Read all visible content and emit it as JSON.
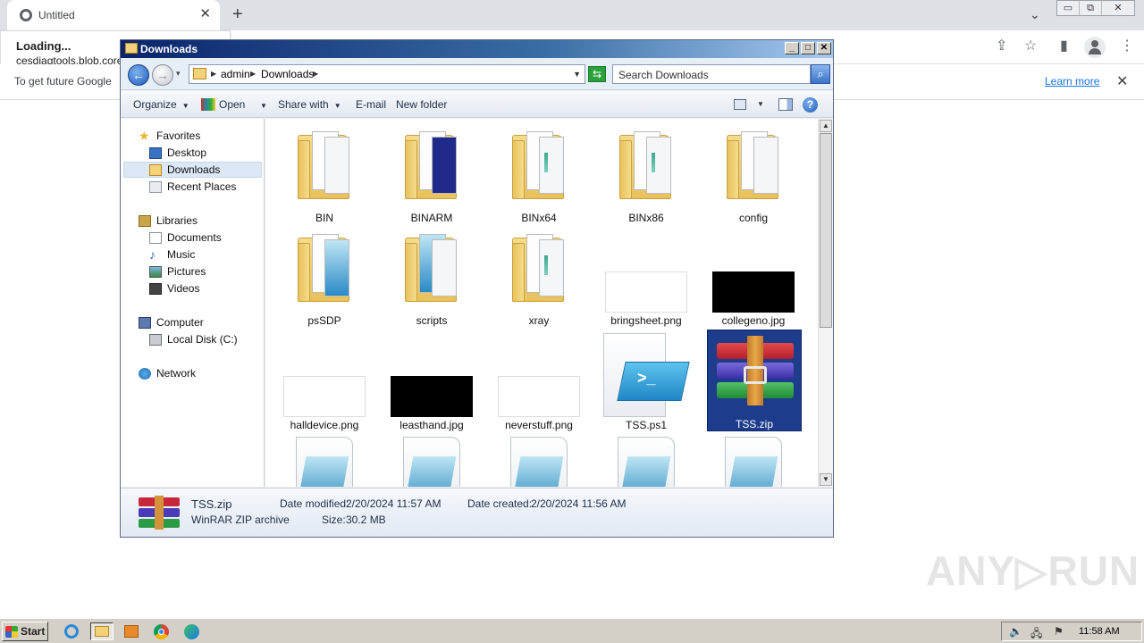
{
  "browser": {
    "tab_title": "Untitled",
    "tab_close": "✕",
    "new_tab": "+",
    "tab_dropdown": "⌄",
    "window_controls": [
      "▭",
      "⧉",
      "✕"
    ],
    "toolbar_icons": {
      "share": "⇪",
      "star": "☆",
      "sidepanel": "▮",
      "menu": "⋮"
    },
    "loading_title": "Loading...",
    "loading_url": "cesdiagtools.blob.core.windows.net",
    "infobar_message": "To get future Google",
    "learn_more": "Learn more",
    "infobar_close": "✕"
  },
  "explorer": {
    "title": "Downloads",
    "title_buttons": [
      "_",
      "□",
      "✕"
    ],
    "nav": {
      "back": "←",
      "forward": "→",
      "history": "▾"
    },
    "address": {
      "crumbs": [
        "admin",
        "Downloads"
      ],
      "arrow": "▶",
      "dropdown": "▼"
    },
    "refresh": "⇆",
    "search_placeholder": "Search Downloads",
    "search_button": "⌕",
    "commands": {
      "organize": "Organize",
      "open": "Open",
      "share_with": "Share with",
      "email": "E-mail",
      "new_folder": "New folder",
      "dropdown": "▼",
      "help": "?"
    },
    "nav_pane": {
      "favorites": "Favorites",
      "desktop": "Desktop",
      "downloads": "Downloads",
      "recent_places": "Recent Places",
      "libraries": "Libraries",
      "documents": "Documents",
      "music": "Music",
      "pictures": "Pictures",
      "videos": "Videos",
      "computer": "Computer",
      "local_disk": "Local Disk (C:)",
      "network": "Network"
    },
    "items": {
      "bin": "BIN",
      "binarm": "BINARM",
      "binx64": "BINx64",
      "binx86": "BINx86",
      "config": "config",
      "pssdp": "psSDP",
      "scripts": "scripts",
      "xray": "xray",
      "bringsheet": "bringsheet.png",
      "collegeno": "collegeno.jpg",
      "halldevice": "halldevice.png",
      "leasthand": "leasthand.jpg",
      "neverstuff": "neverstuff.png",
      "tss_ps1": "TSS.ps1",
      "tss_zip": "TSS.zip"
    },
    "scroll": {
      "up": "▲",
      "down": "▼"
    },
    "details": {
      "name": "TSS.zip",
      "type": "WinRAR ZIP archive",
      "date_modified_label": "Date modified:",
      "date_modified": "2/20/2024 11:57 AM",
      "date_created_label": "Date created:",
      "date_created": "2/20/2024 11:56 AM",
      "size_label": "Size:",
      "size": "30.2 MB"
    }
  },
  "watermark": "ANY▷RUN",
  "taskbar": {
    "start": "Start",
    "tray_icons": {
      "volume": "🔈",
      "network": "🖧",
      "flag": "⚑"
    },
    "clock": "11:58 AM"
  },
  "colors": {
    "selection": "#1e3c8c",
    "titlebar": "#0a246a",
    "link": "#1a73e8"
  }
}
